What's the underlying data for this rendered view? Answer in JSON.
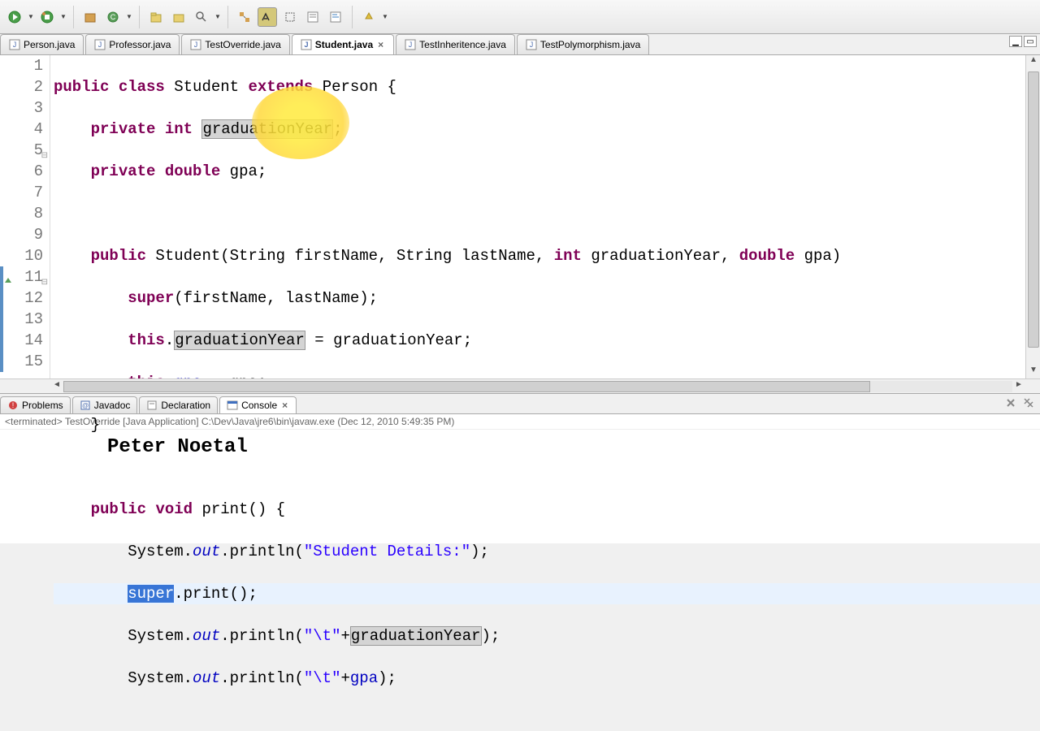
{
  "toolbar": {
    "run": "run",
    "debug": "debug"
  },
  "tabs": [
    {
      "label": "Person.java",
      "active": false
    },
    {
      "label": "Professor.java",
      "active": false
    },
    {
      "label": "TestOverride.java",
      "active": false
    },
    {
      "label": "Student.java",
      "active": true,
      "closable": true
    },
    {
      "label": "TestInheritence.java",
      "active": false
    },
    {
      "label": "TestPolymorphism.java",
      "active": false
    }
  ],
  "code": {
    "lines": [
      {
        "n": 1,
        "raw": "public class Student extends Person {"
      },
      {
        "n": 2,
        "raw": "    private int graduationYear;"
      },
      {
        "n": 3,
        "raw": "    private double gpa;"
      },
      {
        "n": 4,
        "raw": ""
      },
      {
        "n": 5,
        "raw": "    public Student(String firstName, String lastName, int graduationYear, double gpa)"
      },
      {
        "n": 6,
        "raw": "        super(firstName, lastName);"
      },
      {
        "n": 7,
        "raw": "        this.graduationYear = graduationYear;"
      },
      {
        "n": 8,
        "raw": "        this.gpa = gpa;"
      },
      {
        "n": 9,
        "raw": "    }"
      },
      {
        "n": 10,
        "raw": ""
      },
      {
        "n": 11,
        "raw": "    public void print() {"
      },
      {
        "n": 12,
        "raw": "        System.out.println(\"Student Details:\");"
      },
      {
        "n": 13,
        "raw": "        super.print();"
      },
      {
        "n": 14,
        "raw": "        System.out.println(\"\\t\"+graduationYear);"
      },
      {
        "n": 15,
        "raw": "        System.out.println(\"\\t\"+gpa);"
      }
    ],
    "highlighted_line": 13,
    "selected_text": "super",
    "occurrence_highlight": "graduationYear",
    "change_marker_lines": [
      11,
      12,
      13,
      14,
      15
    ]
  },
  "bottom_tabs": [
    {
      "label": "Problems",
      "icon": "problems"
    },
    {
      "label": "Javadoc",
      "icon": "javadoc"
    },
    {
      "label": "Declaration",
      "icon": "declaration"
    },
    {
      "label": "Console",
      "icon": "console",
      "active": true,
      "closable": true
    }
  ],
  "console": {
    "status": "<terminated> TestOverride [Java Application] C:\\Dev\\Java\\jre6\\bin\\javaw.exe (Dec 12, 2010 5:49:35 PM)",
    "output": "Peter Noetal"
  }
}
